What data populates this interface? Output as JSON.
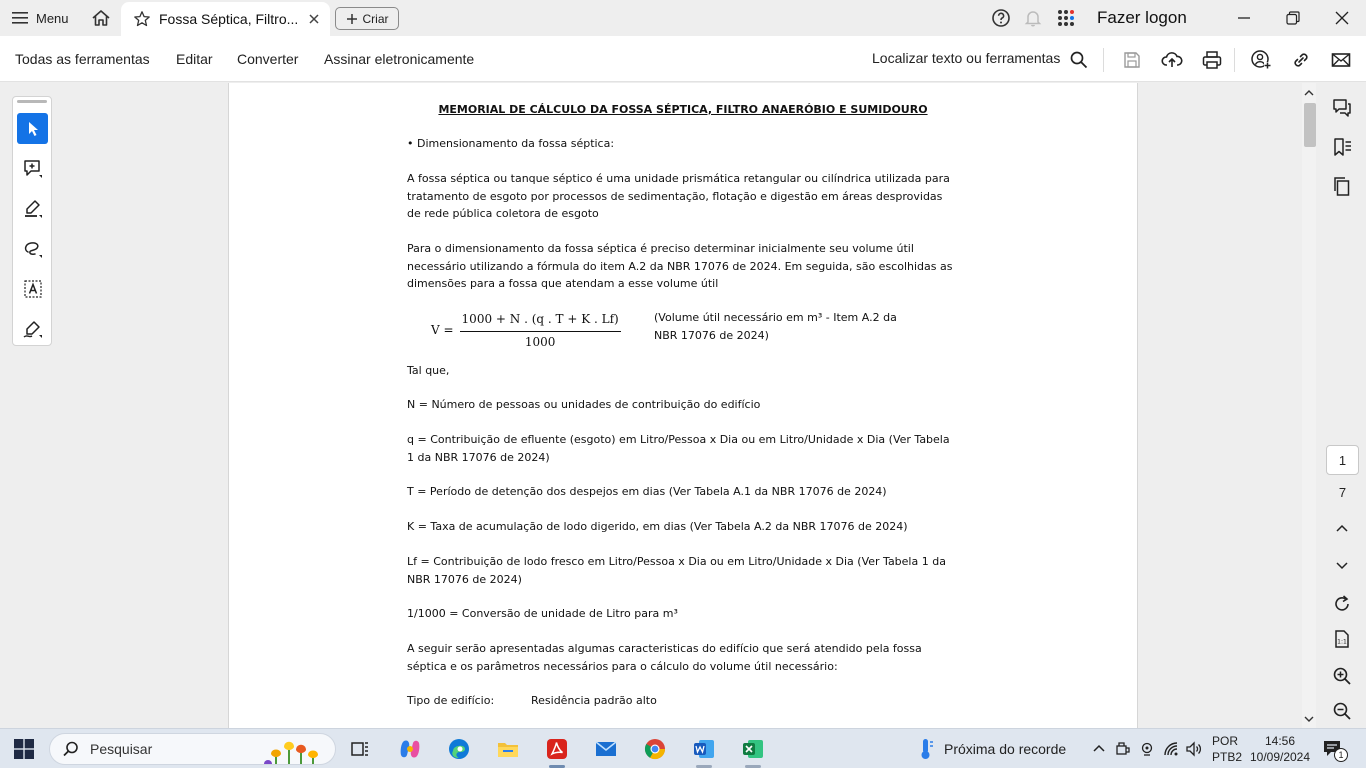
{
  "titlebar": {
    "menu_label": "Menu",
    "tab_title": "Fossa Séptica, Filtro...",
    "create_label": "Criar",
    "logon_label": "Fazer logon"
  },
  "toolbar": {
    "menus": [
      "Todas as ferramentas",
      "Editar",
      "Converter",
      "Assinar eletronicamente"
    ],
    "find_label": "Localizar texto ou ferramentas"
  },
  "document": {
    "heading": "MEMORIAL DE CÁLCULO DA FOSSA SÉPTICA, FILTRO ANAERÓBIO E SUMIDOURO",
    "bullet": "• Dimensionamento da fossa séptica:",
    "p1": "A fossa séptica ou tanque séptico é uma unidade prismática retangular ou cilíndrica utilizada para tratamento de esgoto por processos de sedimentação, flotação e digestão em áreas desprovidas de rede pública coletora de esgoto",
    "p2": "Para o dimensionamento da fossa séptica é preciso determinar inicialmente seu volume útil necessário utilizando a fórmula do item A.2 da NBR 17076 de 2024. Em seguida, são escolhidas as dimensões para a fossa que atendam a esse volume útil",
    "formula_lhs": "V =",
    "formula_num": "1000 + N . (q . T + K . Lf)",
    "formula_den": "1000",
    "formula_note": "(Volume útil necessário em m³ - Item A.2 da NBR 17076 de 2024)",
    "tal_que": "Tal que,",
    "def_n": "N = Número de pessoas ou unidades de contribuição do edifício",
    "def_q": "q = Contribuição de efluente (esgoto) em Litro/Pessoa x Dia ou em Litro/Unidade x Dia (Ver Tabela 1 da NBR 17076 de 2024)",
    "def_t": "T = Período de detenção dos despejos em dias (Ver Tabela A.1 da NBR 17076 de 2024)",
    "def_k": "K = Taxa de acumulação de lodo digerido, em dias (Ver Tabela A.2 da NBR 17076 de 2024)",
    "def_lf": "Lf = Contribuição de lodo fresco em Litro/Pessoa x Dia ou em Litro/Unidade x Dia (Ver Tabela 1 da NBR 17076 de 2024)",
    "def_conv": "1/1000 = Conversão de unidade de Litro para m³",
    "p3": "A seguir serão apresentadas algumas caracteristicas do edifício que será atendido pela fossa séptica e os parâmetros necessários para o cálculo do volume útil necessário:",
    "tipo_label": "Tipo de edifício:",
    "tipo_value": "Residência padrão alto"
  },
  "pager": {
    "current_page": "1",
    "total_pages": "7"
  },
  "taskbar": {
    "search_placeholder": "Pesquisar",
    "weather_text": "Próxima do recorde",
    "lang_line1": "POR",
    "lang_line2": "PTB2",
    "time": "14:56",
    "date": "10/09/2024",
    "notification_count": "1"
  },
  "colors": {
    "accent": "#1473e6",
    "pdf_red": "#d9241c",
    "word_blue": "#185abd",
    "excel_green": "#107c41"
  }
}
